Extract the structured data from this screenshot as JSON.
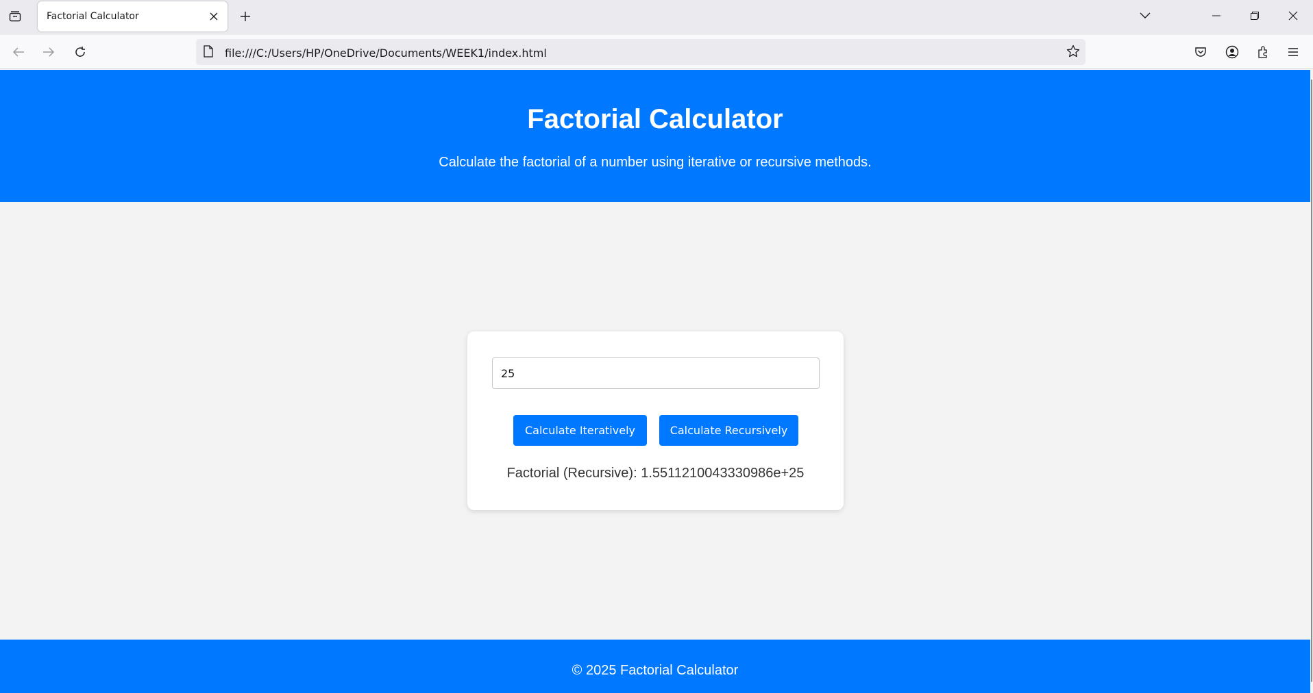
{
  "browser": {
    "tab_title": "Factorial Calculator",
    "url": "file:///C:/Users/HP/OneDrive/Documents/WEEK1/index.html",
    "icons": {
      "tab_list": "tab-list-icon",
      "close_tab": "close-icon",
      "new_tab": "plus-icon",
      "list_all_tabs": "chevron-down-icon",
      "minimize": "minimize-icon",
      "restore": "restore-icon",
      "close_window": "close-icon",
      "back": "back-arrow-icon",
      "forward": "forward-arrow-icon",
      "reload": "reload-icon",
      "page": "page-icon",
      "bookmark": "star-icon",
      "pocket": "pocket-icon",
      "account": "account-icon",
      "extensions": "extensions-icon",
      "menu": "hamburger-menu-icon"
    }
  },
  "page": {
    "header": {
      "title": "Factorial Calculator",
      "subtitle": "Calculate the factorial of a number using iterative or recursive methods."
    },
    "calculator": {
      "input_value": "25",
      "iterative_button": "Calculate Iteratively",
      "recursive_button": "Calculate Recursively",
      "result": "Factorial (Recursive): 1.5511210043330986e+25"
    },
    "footer": {
      "text": "© 2025 Factorial Calculator"
    }
  },
  "colors": {
    "brand_blue": "#0078ff",
    "page_background": "#f3f3f3",
    "card_background": "#ffffff"
  }
}
